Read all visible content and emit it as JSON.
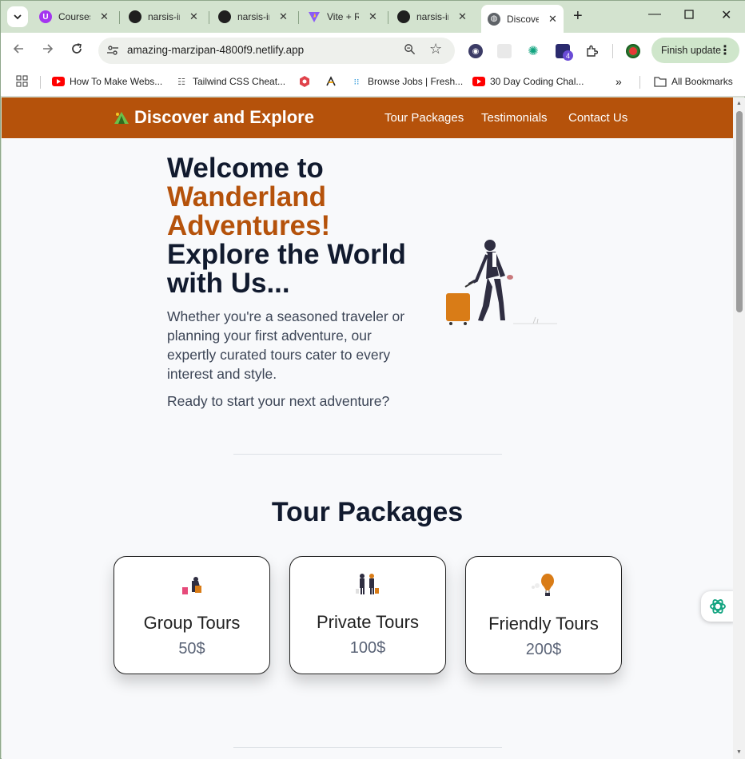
{
  "browser": {
    "tabs": [
      {
        "title": "Courses",
        "icon": "udemy-icon",
        "color": "#a435f0"
      },
      {
        "title": "narsis-ir",
        "icon": "github-icon",
        "color": "#1f1f1f"
      },
      {
        "title": "narsis-ir",
        "icon": "github-icon",
        "color": "#1f1f1f"
      },
      {
        "title": "Vite + R",
        "icon": "vite-icon",
        "color": "#8b5cf6"
      },
      {
        "title": "narsis-ir",
        "icon": "github-icon",
        "color": "#1f1f1f"
      },
      {
        "title": "Discover",
        "icon": "globe-icon",
        "color": "#5f6368",
        "active": true
      }
    ],
    "url": "amazing-marzipan-4800f9.netlify.app",
    "update_button": "Finish update",
    "extension_badge": "4",
    "bookmarks": [
      {
        "label": "How To Make Webs...",
        "icon": "youtube-icon"
      },
      {
        "label": "Tailwind CSS Cheat...",
        "icon": "tailwind-icon"
      },
      {
        "label": "",
        "icon": "react-icon"
      },
      {
        "label": "",
        "icon": "freshworks-icon"
      },
      {
        "label": "Browse Jobs | Fresh...",
        "icon": "jobs-icon"
      },
      {
        "label": "30 Day Coding Chal...",
        "icon": "youtube-icon"
      }
    ],
    "all_bookmarks": "All Bookmarks"
  },
  "site": {
    "brand": "Discover and Explore",
    "nav": [
      "Tour Packages",
      "Testimonials",
      "Contact Us"
    ],
    "hero": {
      "line1": "Welcome to",
      "accent": "Wanderland Adventures!",
      "line2": "Explore the World with Us...",
      "paragraph": "Whether you're a seasoned traveler or planning your first adventure, our expertly curated tours cater to every interest and style.",
      "cta": "Ready to start your next adventure?"
    },
    "packages_title": "Tour Packages",
    "packages": [
      {
        "name": "Group Tours",
        "price": "50$"
      },
      {
        "name": "Private Tours",
        "price": "100$"
      },
      {
        "name": "Friendly Tours",
        "price": "200$"
      }
    ],
    "colors": {
      "brand": "#b5520b",
      "heading": "#111a2e"
    }
  }
}
